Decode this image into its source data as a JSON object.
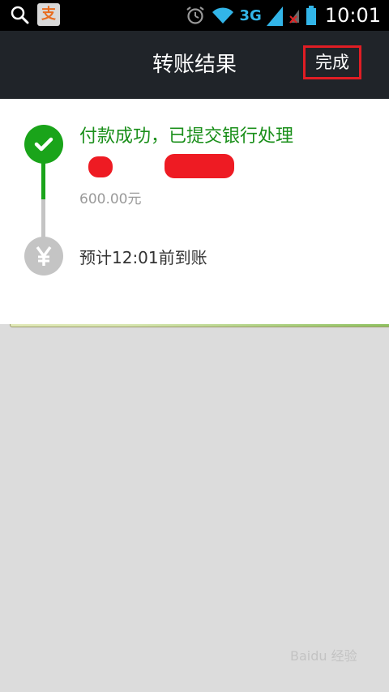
{
  "status_bar": {
    "alipay_glyph": "支",
    "network": "3G",
    "time": "10:01"
  },
  "header": {
    "title": "转账结果",
    "done_label": "完成"
  },
  "steps": [
    {
      "title": "付款成功，已提交银行处理",
      "bank": "",
      "amount": "600.00元"
    },
    {
      "title": "预计12:01前到账"
    }
  ],
  "colors": {
    "success": "#1aa41a",
    "pending": "#c4c4c4",
    "highlight": "#e01d24",
    "header_bg": "#202429"
  },
  "watermark": "Baidu 经验"
}
